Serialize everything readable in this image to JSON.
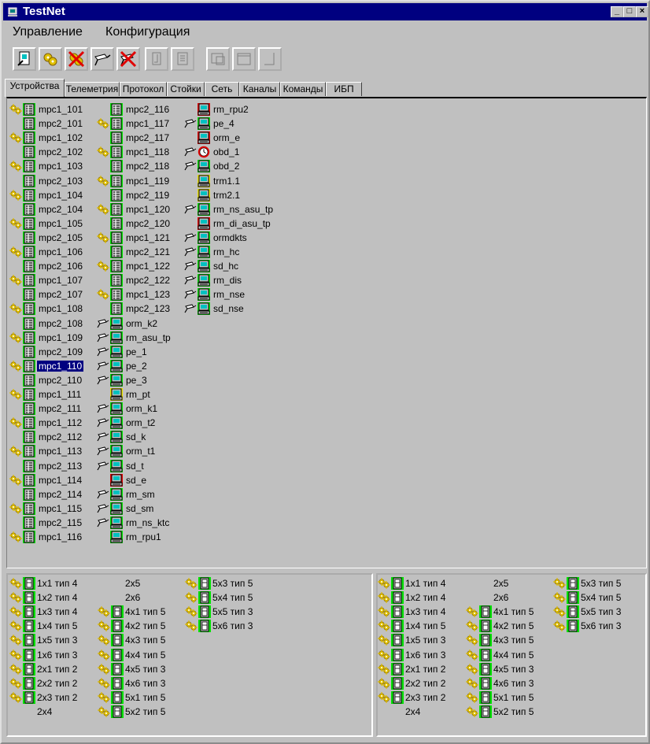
{
  "window": {
    "title": "TestNet"
  },
  "menu": [
    "Управление",
    "Конфигурация"
  ],
  "toolbar": [
    "connect-icon",
    "gear-icon",
    "stop-gear-icon",
    "comm-icon",
    "stop-comm-icon",
    "doc-icon",
    "list-icon",
    "window-icon",
    "window2-icon",
    "window3-icon"
  ],
  "tabs": [
    "Устройства",
    "Телеметрия",
    "Протокол",
    "Стойки",
    "Сеть",
    "Каналы",
    "Команды",
    "ИБП"
  ],
  "devices": {
    "col1": [
      {
        "label": "mpc1_101",
        "gear": true
      },
      {
        "label": "mpc2_101",
        "gear": false
      },
      {
        "label": "mpc1_102",
        "gear": true
      },
      {
        "label": "mpc2_102",
        "gear": false
      },
      {
        "label": "mpc1_103",
        "gear": true
      },
      {
        "label": "mpc2_103",
        "gear": false
      },
      {
        "label": "mpc1_104",
        "gear": true
      },
      {
        "label": "mpc2_104",
        "gear": false
      },
      {
        "label": "mpc1_105",
        "gear": true
      },
      {
        "label": "mpc2_105",
        "gear": false
      },
      {
        "label": "mpc1_106",
        "gear": true
      },
      {
        "label": "mpc2_106",
        "gear": false
      },
      {
        "label": "mpc1_107",
        "gear": true
      },
      {
        "label": "mpc2_107",
        "gear": false
      },
      {
        "label": "mpc1_108",
        "gear": true
      },
      {
        "label": "mpc2_108",
        "gear": false
      },
      {
        "label": "mpc1_109",
        "gear": true
      },
      {
        "label": "mpc2_109",
        "gear": false
      },
      {
        "label": "mpc1_110",
        "gear": true,
        "selected": true
      },
      {
        "label": "mpc2_110",
        "gear": false
      },
      {
        "label": "mpc1_111",
        "gear": true
      },
      {
        "label": "mpc2_111",
        "gear": false
      },
      {
        "label": "mpc1_112",
        "gear": true
      },
      {
        "label": "mpc2_112",
        "gear": false
      },
      {
        "label": "mpc1_113",
        "gear": true
      },
      {
        "label": "mpc2_113",
        "gear": false
      },
      {
        "label": "mpc1_114",
        "gear": true
      },
      {
        "label": "mpc2_114",
        "gear": false
      },
      {
        "label": "mpc1_115",
        "gear": true
      },
      {
        "label": "mpc2_115",
        "gear": false
      },
      {
        "label": "mpc1_116",
        "gear": true
      }
    ],
    "col2": [
      {
        "label": "mpc2_116",
        "kind": "mpc",
        "pre": ""
      },
      {
        "label": "mpc1_117",
        "kind": "mpc",
        "pre": "gear"
      },
      {
        "label": "mpc2_117",
        "kind": "mpc",
        "pre": ""
      },
      {
        "label": "mpc1_118",
        "kind": "mpc",
        "pre": "gear"
      },
      {
        "label": "mpc2_118",
        "kind": "mpc",
        "pre": ""
      },
      {
        "label": "mpc1_119",
        "kind": "mpc",
        "pre": "gear"
      },
      {
        "label": "mpc2_119",
        "kind": "mpc",
        "pre": ""
      },
      {
        "label": "mpc1_120",
        "kind": "mpc",
        "pre": "gear"
      },
      {
        "label": "mpc2_120",
        "kind": "mpc",
        "pre": ""
      },
      {
        "label": "mpc1_121",
        "kind": "mpc",
        "pre": "gear"
      },
      {
        "label": "mpc2_121",
        "kind": "mpc",
        "pre": ""
      },
      {
        "label": "mpc1_122",
        "kind": "mpc",
        "pre": "gear"
      },
      {
        "label": "mpc2_122",
        "kind": "mpc",
        "pre": ""
      },
      {
        "label": "mpc1_123",
        "kind": "mpc",
        "pre": "gear"
      },
      {
        "label": "mpc2_123",
        "kind": "mpc",
        "pre": ""
      },
      {
        "label": "orm_k2",
        "kind": "pc-green",
        "pre": "comm"
      },
      {
        "label": "rm_asu_tp",
        "kind": "pc-green",
        "pre": "comm"
      },
      {
        "label": "pe_1",
        "kind": "pc-green",
        "pre": "comm"
      },
      {
        "label": "pe_2",
        "kind": "pc-green",
        "pre": "comm"
      },
      {
        "label": "pe_3",
        "kind": "pc-green",
        "pre": "comm"
      },
      {
        "label": "rm_pt",
        "kind": "pc-yellow",
        "pre": ""
      },
      {
        "label": "orm_k1",
        "kind": "pc-green",
        "pre": "comm"
      },
      {
        "label": "orm_t2",
        "kind": "pc-green",
        "pre": "comm"
      },
      {
        "label": "sd_k",
        "kind": "pc-green",
        "pre": "comm"
      },
      {
        "label": "orm_t1",
        "kind": "pc-green",
        "pre": "comm"
      },
      {
        "label": "sd_t",
        "kind": "pc-green",
        "pre": "comm"
      },
      {
        "label": "sd_e",
        "kind": "pc-red",
        "pre": ""
      },
      {
        "label": "rm_sm",
        "kind": "pc-green",
        "pre": "comm"
      },
      {
        "label": "sd_sm",
        "kind": "pc-green",
        "pre": "comm"
      },
      {
        "label": "rm_ns_ktc",
        "kind": "pc-green",
        "pre": "comm"
      },
      {
        "label": "rm_rpu1",
        "kind": "pc-green",
        "pre": ""
      }
    ],
    "col3": [
      {
        "label": "rm_rpu2",
        "kind": "pc-red",
        "pre": ""
      },
      {
        "label": "pe_4",
        "kind": "pc-green",
        "pre": "comm"
      },
      {
        "label": "orm_e",
        "kind": "pc-red",
        "pre": ""
      },
      {
        "label": "obd_1",
        "kind": "clock",
        "pre": "comm"
      },
      {
        "label": "obd_2",
        "kind": "pc-green",
        "pre": "comm"
      },
      {
        "label": "trm1.1",
        "kind": "pc-yellow",
        "pre": ""
      },
      {
        "label": "trm2.1",
        "kind": "pc-yellow",
        "pre": ""
      },
      {
        "label": "rm_ns_asu_tp",
        "kind": "pc-green",
        "pre": "comm"
      },
      {
        "label": "rm_di_asu_tp",
        "kind": "pc-red",
        "pre": ""
      },
      {
        "label": "ormdkts",
        "kind": "pc-green",
        "pre": "comm"
      },
      {
        "label": "rm_hc",
        "kind": "pc-green",
        "pre": "comm"
      },
      {
        "label": "sd_hc",
        "kind": "pc-green",
        "pre": "comm"
      },
      {
        "label": "rm_dis",
        "kind": "pc-green",
        "pre": "comm"
      },
      {
        "label": "rm_nse",
        "kind": "pc-green",
        "pre": "comm"
      },
      {
        "label": "sd_nse",
        "kind": "pc-green",
        "pre": "comm"
      }
    ]
  },
  "racks_left": {
    "col1": [
      {
        "label": "1x1 тип 4",
        "icon": true
      },
      {
        "label": "1x2 тип 4",
        "icon": true
      },
      {
        "label": "1x3 тип 4",
        "icon": true
      },
      {
        "label": "1x4 тип 5",
        "icon": true
      },
      {
        "label": "1x5 тип 3",
        "icon": true
      },
      {
        "label": "1x6 тип 3",
        "icon": true
      },
      {
        "label": "2x1 тип 2",
        "icon": true
      },
      {
        "label": "2x2 тип 2",
        "icon": true
      },
      {
        "label": "2x3 тип 2",
        "icon": true
      },
      {
        "label": "2x4",
        "icon": false
      }
    ],
    "col2": [
      {
        "label": "2x5",
        "icon": false
      },
      {
        "label": "2x6",
        "icon": false
      },
      {
        "label": "4x1 тип 5",
        "icon": true
      },
      {
        "label": "4x2 тип 5",
        "icon": true
      },
      {
        "label": "4x3 тип 5",
        "icon": true
      },
      {
        "label": "4x4 тип 5",
        "icon": true
      },
      {
        "label": "4x5 тип 3",
        "icon": true
      },
      {
        "label": "4x6 тип 3",
        "icon": true
      },
      {
        "label": "5x1 тип 5",
        "icon": true
      },
      {
        "label": "5x2 тип 5",
        "icon": true
      }
    ],
    "col3": [
      {
        "label": "5x3 тип 5",
        "icon": true
      },
      {
        "label": "5x4 тип 5",
        "icon": true
      },
      {
        "label": "5x5 тип 3",
        "icon": true
      },
      {
        "label": "5x6 тип 3",
        "icon": true
      }
    ]
  },
  "racks_right": {
    "col1": [
      {
        "label": "1x1 тип 4",
        "icon": true
      },
      {
        "label": "1x2 тип 4",
        "icon": true
      },
      {
        "label": "1x3 тип 4",
        "icon": true
      },
      {
        "label": "1x4 тип 5",
        "icon": true
      },
      {
        "label": "1x5 тип 3",
        "icon": true
      },
      {
        "label": "1x6 тип 3",
        "icon": true
      },
      {
        "label": "2x1 тип 2",
        "icon": true
      },
      {
        "label": "2x2 тип 2",
        "icon": true
      },
      {
        "label": "2x3 тип 2",
        "icon": true
      },
      {
        "label": "2x4",
        "icon": false
      }
    ],
    "col2": [
      {
        "label": "2x5",
        "icon": false
      },
      {
        "label": "2x6",
        "icon": false
      },
      {
        "label": "4x1 тип 5",
        "icon": true
      },
      {
        "label": "4x2 тип 5",
        "icon": true
      },
      {
        "label": "4x3 тип 5",
        "icon": true
      },
      {
        "label": "4x4 тип 5",
        "icon": true
      },
      {
        "label": "4x5 тип 3",
        "icon": true
      },
      {
        "label": "4x6 тип 3",
        "icon": true
      },
      {
        "label": "5x1 тип 5",
        "icon": true
      },
      {
        "label": "5x2 тип 5",
        "icon": true
      }
    ],
    "col3": [
      {
        "label": "5x3 тип 5",
        "icon": true
      },
      {
        "label": "5x4 тип 5",
        "icon": true
      },
      {
        "label": "5x5 тип 3",
        "icon": true
      },
      {
        "label": "5x6 тип 3",
        "icon": true
      }
    ]
  },
  "colors": {
    "selection": "#000080",
    "green": "#00e000",
    "red": "#e00000",
    "yellow": "#e8e000",
    "gear": "#e0c000"
  }
}
